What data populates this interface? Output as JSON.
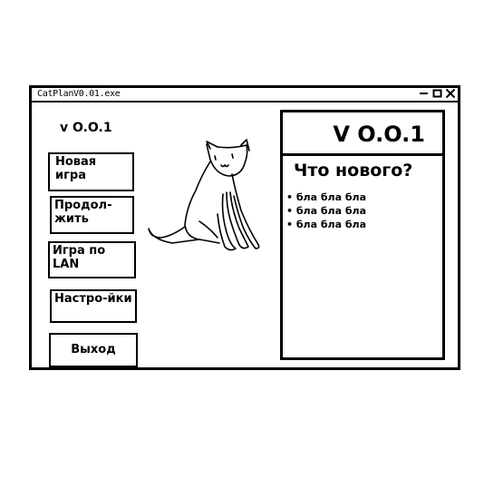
{
  "window": {
    "title": "CatPlanV0.01.exe",
    "controls": {
      "minimize_icon": "minimize-icon",
      "maximize_icon": "maximize-icon",
      "close_icon": "close-icon"
    }
  },
  "sidebar": {
    "version": "v O.O.1",
    "buttons": {
      "new_game": "Новая игра",
      "continue": "Продол-жить",
      "lan": "Игра по LAN",
      "settings": "Настро-йки",
      "exit": "Выход"
    }
  },
  "illustration": {
    "icon": "cat-sketch"
  },
  "news": {
    "version": "V O.O.1",
    "title": "Что нового?",
    "items": [
      "бла бла бла",
      "бла бла бла",
      "бла бла бла"
    ]
  },
  "colors": {
    "ink": "#000000",
    "background": "#ffffff"
  }
}
